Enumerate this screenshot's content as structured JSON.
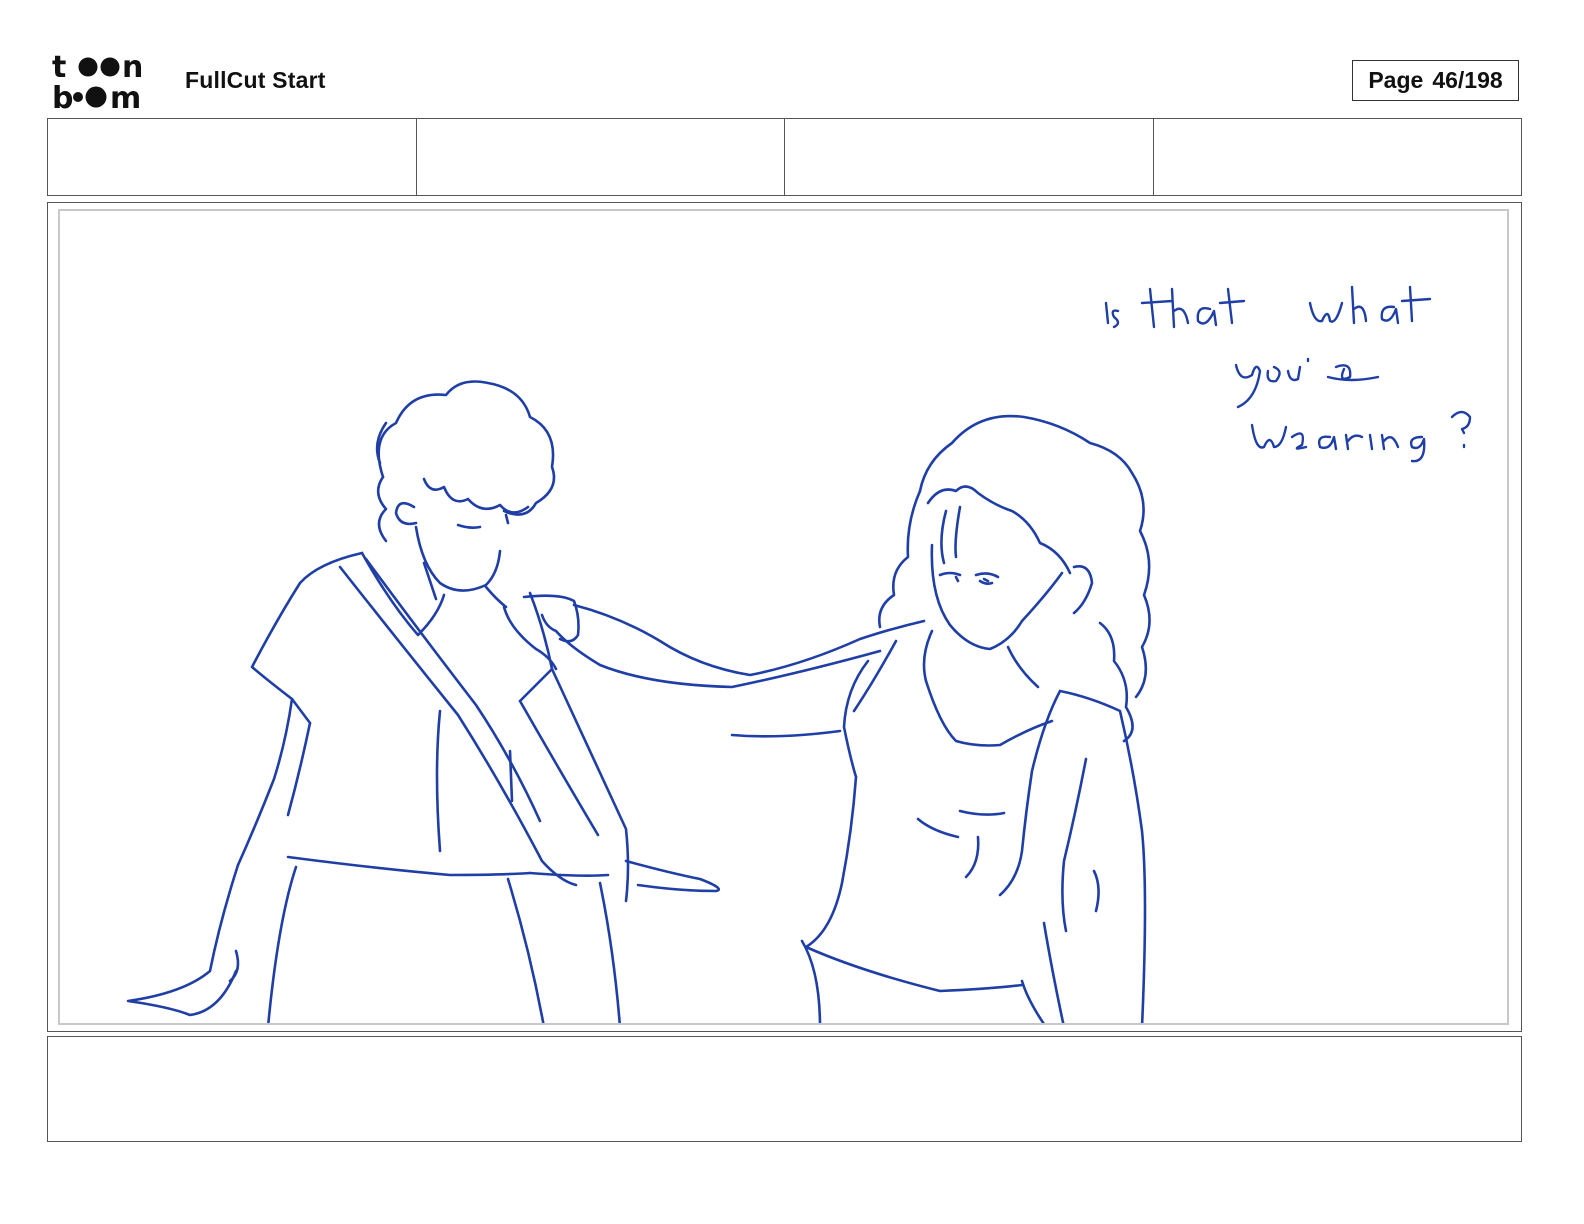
{
  "header": {
    "logo_text": "toon boom",
    "document_title": "FullCut Start",
    "page_label": "Page",
    "page_number": "46/198"
  },
  "fields": [
    "",
    "",
    "",
    ""
  ],
  "panel": {
    "handwritten_caption": "is that what you're wearing?",
    "sketch_color": "#1f3fa6"
  },
  "notes": ""
}
